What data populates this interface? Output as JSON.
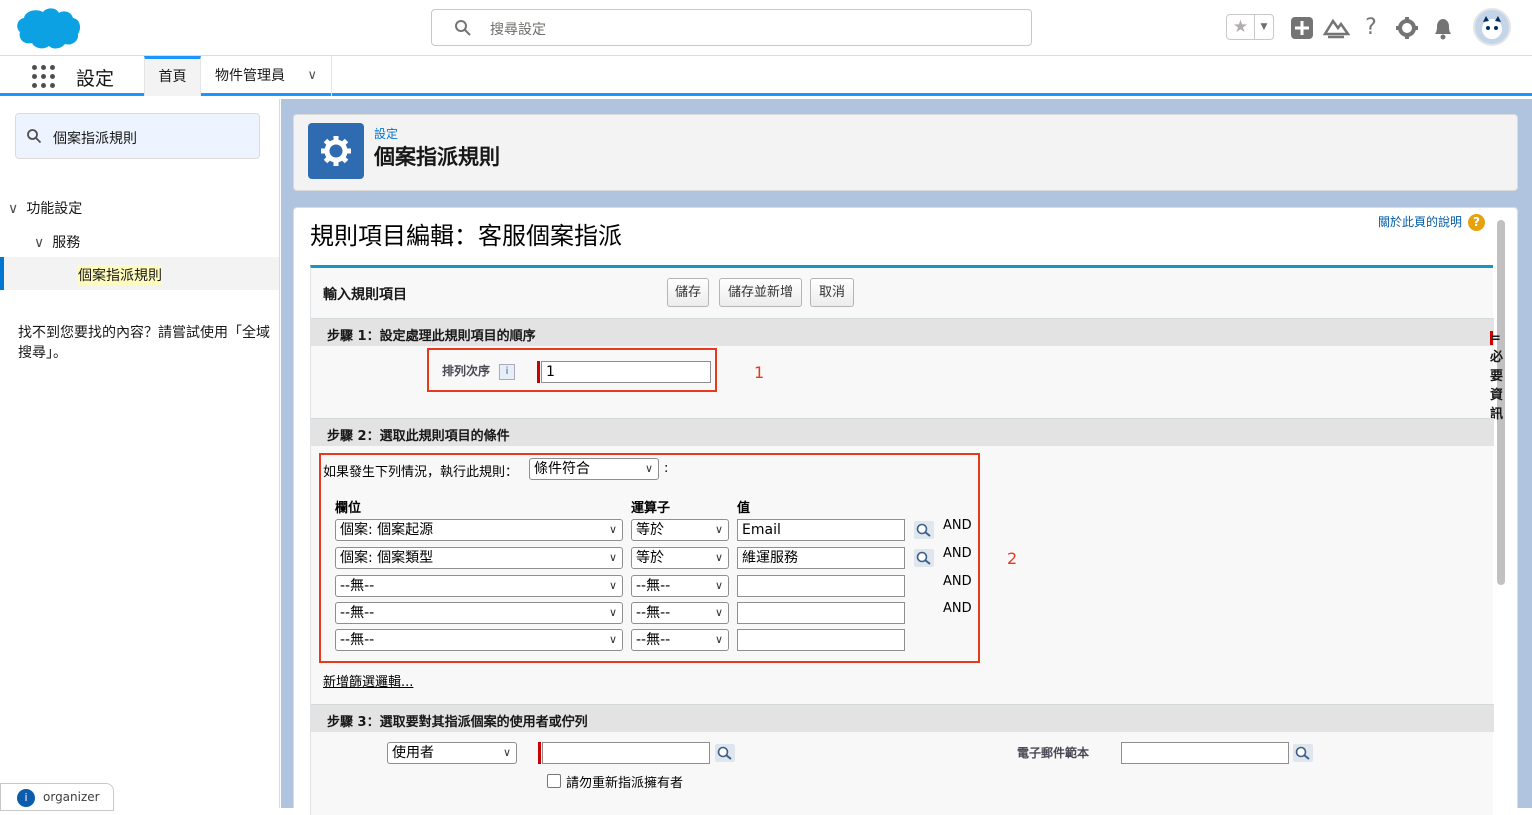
{
  "header": {
    "search_placeholder": "搜尋設定",
    "icons": [
      "star-icon",
      "add-icon",
      "trailhead-icon",
      "help-icon",
      "gear-icon",
      "bell-icon"
    ]
  },
  "context_bar": {
    "app_name": "設定",
    "tabs": [
      {
        "label": "首頁",
        "active": true
      },
      {
        "label": "物件管理員",
        "has_dropdown": true
      }
    ]
  },
  "sidebar": {
    "quickfind_value": "個案指派規則",
    "tree": {
      "level1": "功能設定",
      "level2": "服務",
      "level3": "個案指派規則"
    },
    "not_found_text": "找不到您要找的內容？請嘗試使用「全域搜尋」。",
    "organizer_label": "organizer"
  },
  "page_header": {
    "breadcrumb": "設定",
    "title": "個案指派規則"
  },
  "content": {
    "heading": "規則項目編輯：客服個案指派",
    "help_link": "關於此頁的說明",
    "help_badge": "?",
    "block_title": "輸入規則項目",
    "buttons": {
      "save": "儲存",
      "save_new": "儲存並新增",
      "cancel": "取消"
    },
    "required_note": "= 必要資訊",
    "step1": {
      "title": "步驟 1：設定處理此規則項目的順序",
      "sort_label": "排列次序",
      "sort_value": "1",
      "annotation": "1"
    },
    "step2": {
      "title": "步驟 2：選取此規則項目的條件",
      "condition_prefix": "如果發生下列情況，執行此規則：",
      "condition_value": "條件符合",
      "condition_suffix": ":",
      "col_field": "欄位",
      "col_operator": "運算子",
      "col_value": "值",
      "rows": [
        {
          "field": "個案: 個案起源",
          "operator": "等於",
          "value": "Email",
          "and": "AND"
        },
        {
          "field": "個案: 個案類型",
          "operator": "等於",
          "value": "維運服務",
          "and": "AND"
        },
        {
          "field": "--無--",
          "operator": "--無--",
          "value": "",
          "and": "AND"
        },
        {
          "field": "--無--",
          "operator": "--無--",
          "value": "",
          "and": "AND"
        },
        {
          "field": "--無--",
          "operator": "--無--",
          "value": "",
          "and": ""
        }
      ],
      "filter_logic_link": "新增篩選邏輯...",
      "annotation": "2"
    },
    "step3": {
      "title": "步驟 3：選取要對其指派個案的使用者或佇列",
      "assignee_type": "使用者",
      "assignee_value": "",
      "email_template_label": "電子郵件範本",
      "email_template_value": "",
      "checkbox_label": "請勿重新指派擁有者"
    }
  },
  "colors": {
    "brand_blue": "#1b96ff",
    "annotation_red": "#e8391c",
    "section_header": "#e3e3e3",
    "required_red": "#cc0000"
  }
}
